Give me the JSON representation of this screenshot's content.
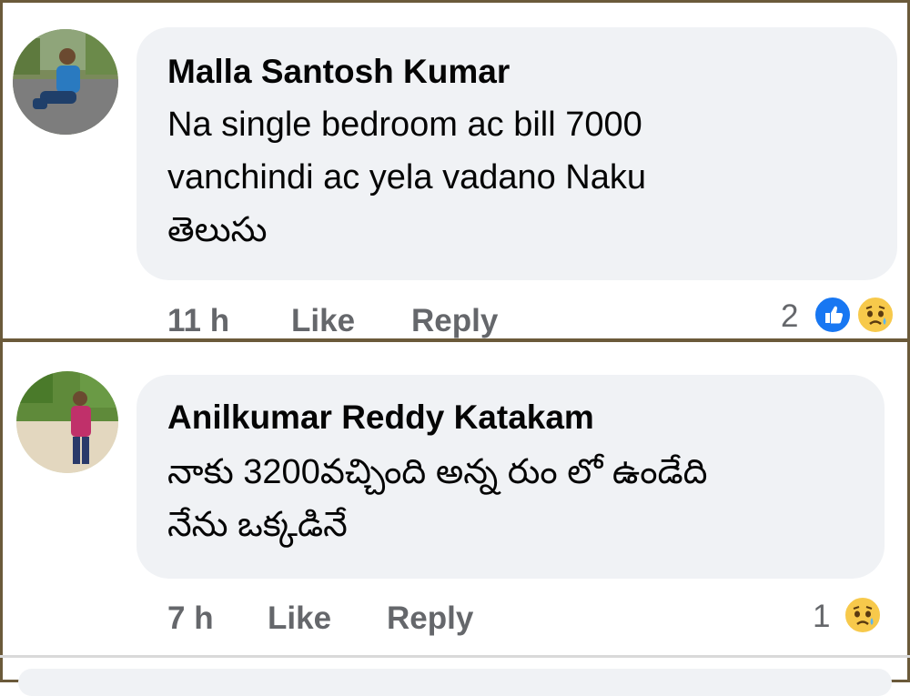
{
  "comments": [
    {
      "author": "Malla Santosh Kumar",
      "text_lines": [
        "Na single bedroom ac bill 7000",
        "vanchindi ac yela vadano Naku",
        "తెలుసు"
      ],
      "time": "11 h",
      "like_label": "Like",
      "reply_label": "Reply",
      "reaction_count": "2",
      "reactions": [
        "like-icon",
        "sad-icon"
      ]
    },
    {
      "author": "Anilkumar Reddy Katakam",
      "text_lines": [
        "నాకు 3200వచ్చింది అన్న రుం లో ఉండేది",
        "నేను ఒక్కడినే"
      ],
      "time": "7 h",
      "like_label": "Like",
      "reply_label": "Reply",
      "reaction_count": "1",
      "reactions": [
        "sad-icon"
      ]
    }
  ],
  "colors": {
    "bubble": "#f0f2f5",
    "meta": "#65676b",
    "text": "#050505",
    "like_blue": "#1877f2",
    "sad_yellow": "#f7c94b",
    "frame": "#6b5a3a"
  }
}
